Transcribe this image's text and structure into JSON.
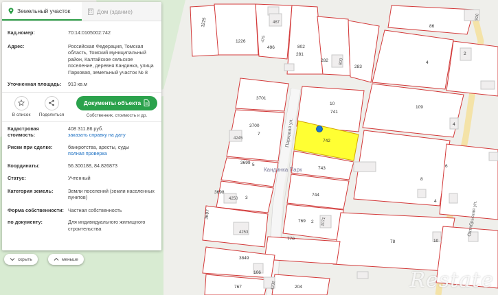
{
  "tabs": {
    "parcel": "Земельный участок",
    "house": "Дом (здание)"
  },
  "fields": {
    "cad_number": {
      "label": "Кад.номер:",
      "value": "70:14:0105002:742"
    },
    "address": {
      "label": "Адрес:",
      "value": "Российская Федерация, Томская область, Томский муниципальный район, Калтайское сельское поселение, деревня Кандинка, улица Парковая, земельный участок № 8"
    },
    "area": {
      "label": "Уточненная площадь:",
      "value": "913 кв.м"
    }
  },
  "actions": {
    "favorite": "В список",
    "share": "Поделиться",
    "docs_button": "Документы объекта",
    "docs_sub": "Собственник, стоимость и др."
  },
  "details": {
    "cad_value": {
      "label_1": "Кадастровая",
      "label_2": "стоимость:",
      "value": "408 311.86 руб.",
      "link": "заказать справку на дату"
    },
    "risks": {
      "label": "Риски при сделке:",
      "value": "банкротства, аресты, суды",
      "link": "полная проверка"
    },
    "coords": {
      "label": "Координаты:",
      "value": "56.300188, 84.826873"
    },
    "status": {
      "label": "Статус:",
      "value": "Учтенный"
    },
    "category": {
      "label": "Категория земель:",
      "value": "Земли поселений (земли населенных пунктов)"
    },
    "ownership": {
      "label": "Форма собственности:",
      "value": "Частная собственность"
    },
    "doc_use": {
      "label": "по документу:",
      "value": "Для индивидуального жилищного строительства"
    }
  },
  "controls": {
    "hide": "скрыть",
    "less": "меньше"
  },
  "map": {
    "selected_parcel": "742",
    "parcels": [
      "1225",
      "467",
      "1226",
      "475",
      "496",
      "802",
      "281",
      "282",
      "800",
      "283",
      "86",
      "920",
      "2",
      "4",
      "109",
      "4",
      "3701",
      "10",
      "741",
      "3700",
      "7",
      "4245",
      "743",
      "3699",
      "5",
      "744",
      "3698",
      "4250",
      "3",
      "769",
      "2",
      "1071",
      "3697",
      "4253",
      "770",
      "78",
      "10",
      "3849",
      "106",
      "767",
      "4232",
      "204",
      "6",
      "8",
      "4"
    ],
    "streets": {
      "parkovaya": "Парковая ул.",
      "oktyabrskaya": "Октябрьская ул."
    },
    "place": "Кандинка Парк"
  },
  "watermark": "Restate",
  "colors": {
    "accent": "#2ba24c",
    "link": "#1b6fc2",
    "parcel_border": "#d33a3a",
    "selected_fill": "#ffff33"
  }
}
